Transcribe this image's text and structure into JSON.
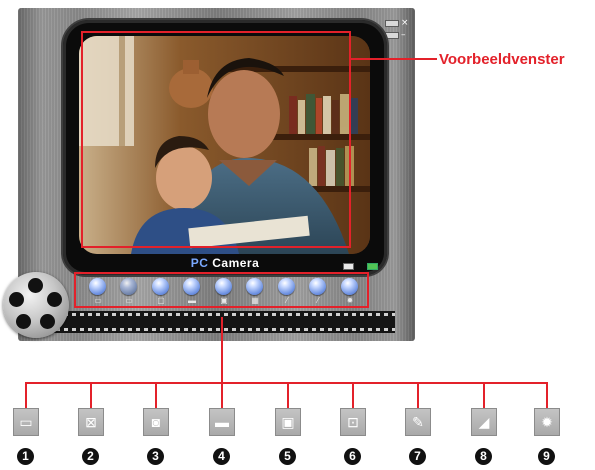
{
  "annotation": {
    "preview_label": "Voorbeeldvenster",
    "accent": "#e3212a"
  },
  "window": {
    "controls": [
      {
        "name": "close-icon",
        "glyph": "×"
      },
      {
        "name": "minimize-icon",
        "glyph": "–"
      }
    ],
    "brand": {
      "part1": "PC",
      "part2": "Camera"
    },
    "preview": {
      "description_icon": "photo-preview"
    }
  },
  "toolbar": {
    "buttons": [
      {
        "icon": "video-capture-icon",
        "glyph": "▭"
      },
      {
        "icon": "video-off-icon",
        "glyph": "▭"
      },
      {
        "icon": "snapshot-icon",
        "glyph": "▢"
      },
      {
        "icon": "clapper-icon",
        "glyph": "▬"
      },
      {
        "icon": "film-icon",
        "glyph": "▣"
      },
      {
        "icon": "frame-icon",
        "glyph": "▦"
      },
      {
        "icon": "wrench-icon",
        "glyph": "⁄"
      },
      {
        "icon": "eraser-icon",
        "glyph": "⁄"
      },
      {
        "icon": "gear-icon",
        "glyph": "✹"
      }
    ]
  },
  "legend": {
    "items": [
      {
        "number": "1",
        "icon": "video-capture-icon",
        "glyph": "▭"
      },
      {
        "number": "2",
        "icon": "video-off-icon",
        "glyph": "⊠"
      },
      {
        "number": "3",
        "icon": "snapshot-icon",
        "glyph": "◙"
      },
      {
        "number": "4",
        "icon": "clapper-icon",
        "glyph": "▬"
      },
      {
        "number": "5",
        "icon": "film-icon",
        "glyph": "▣"
      },
      {
        "number": "6",
        "icon": "frame-icon",
        "glyph": "⊡"
      },
      {
        "number": "7",
        "icon": "wrench-icon",
        "glyph": "✎"
      },
      {
        "number": "8",
        "icon": "eraser-icon",
        "glyph": "◢"
      },
      {
        "number": "9",
        "icon": "gear-icon",
        "glyph": "✹"
      }
    ]
  }
}
